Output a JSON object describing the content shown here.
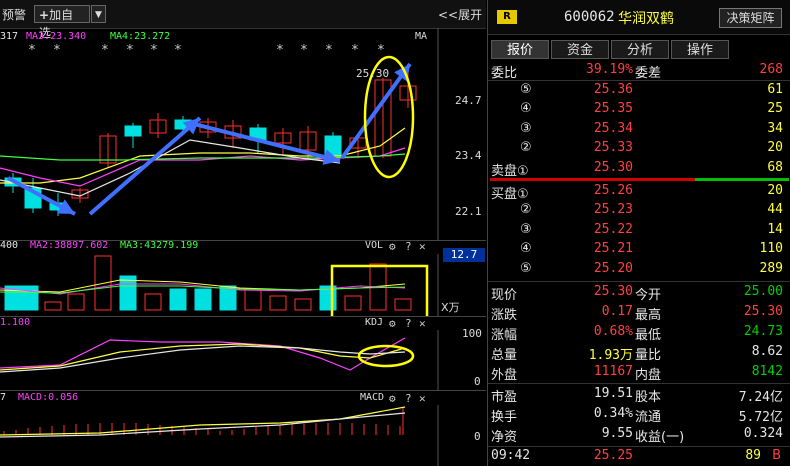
{
  "toolbar": {
    "alert_label": "预警",
    "add_watch_label": "加自选",
    "expand_label": "<<展开"
  },
  "main_chart": {
    "ma_legend": [
      {
        "label": "317",
        "color": "#e6e6e6"
      },
      {
        "label": "MA3:23.340",
        "color": "#ff40ff"
      },
      {
        "label": "MA4:23.272",
        "color": "#40ff40"
      }
    ],
    "ma_tag": "MA",
    "price_labels": [
      "24.7",
      "23.4",
      "22.1"
    ],
    "high_annot": "25.30",
    "star": "*"
  },
  "vol_chart": {
    "legend": [
      {
        "label": "400",
        "color": "#e6e6e6"
      },
      {
        "label": "MA2:38897.602",
        "color": "#ff40ff"
      },
      {
        "label": "MA3:43279.199",
        "color": "#40ff40"
      }
    ],
    "tag": "VOL",
    "value_label": "12.7",
    "unit": "X万"
  },
  "kdj_chart": {
    "legend": "1.100",
    "tag": "KDJ",
    "axis": [
      "100",
      "0"
    ]
  },
  "macd_chart": {
    "legend_left": "7",
    "legend": "MACD:0.056",
    "tag": "MACD",
    "axis": [
      "0"
    ]
  },
  "header": {
    "badge": "R",
    "code": "600062",
    "name": "华润双鹤",
    "decision_button": "决策矩阵"
  },
  "tabs": [
    "报价",
    "资金",
    "分析",
    "操作"
  ],
  "commission": {
    "ratio_label": "委比",
    "ratio_value": "39.19%",
    "diff_label": "委差",
    "diff_value": "268"
  },
  "sell_orders": [
    {
      "level": "⑤",
      "price": "25.36",
      "vol": "61"
    },
    {
      "level": "④",
      "price": "25.35",
      "vol": "25"
    },
    {
      "level": "③",
      "price": "25.34",
      "vol": "34"
    },
    {
      "level": "②",
      "price": "25.33",
      "vol": "20"
    },
    {
      "level": "卖盘①",
      "price": "25.30",
      "vol": "68"
    }
  ],
  "buy_orders": [
    {
      "level": "买盘①",
      "price": "25.26",
      "vol": "20"
    },
    {
      "level": "②",
      "price": "25.23",
      "vol": "44"
    },
    {
      "level": "③",
      "price": "25.22",
      "vol": "14"
    },
    {
      "level": "④",
      "price": "25.21",
      "vol": "110"
    },
    {
      "level": "⑤",
      "price": "25.20",
      "vol": "289"
    }
  ],
  "stats": [
    {
      "l1": "现价",
      "v1": "25.30",
      "c1": "red",
      "l2": "今开",
      "v2": "25.00",
      "c2": "green"
    },
    {
      "l1": "涨跌",
      "v1": "0.17",
      "c1": "red",
      "l2": "最高",
      "v2": "25.30",
      "c2": "red"
    },
    {
      "l1": "涨幅",
      "v1": "0.68%",
      "c1": "red",
      "l2": "最低",
      "v2": "24.73",
      "c2": "green"
    },
    {
      "l1": "总量",
      "v1": "1.93万",
      "c1": "yellow",
      "l2": "量比",
      "v2": "8.62",
      "c2": "white"
    },
    {
      "l1": "外盘",
      "v1": "11167",
      "c1": "red",
      "l2": "内盘",
      "v2": "8142",
      "c2": "green"
    }
  ],
  "fundamentals": [
    {
      "l1": "市盈",
      "v1": "19.51",
      "l2": "股本",
      "v2": "7.24亿"
    },
    {
      "l1": "换手",
      "v1": "0.34%",
      "l2": "流通",
      "v2": "5.72亿"
    },
    {
      "l1": "净资",
      "v1": "9.55",
      "l2": "收益(一)",
      "v2": "0.324"
    }
  ],
  "tick": {
    "time": "09:42",
    "price": "25.25",
    "vol": "89",
    "side": "B"
  }
}
